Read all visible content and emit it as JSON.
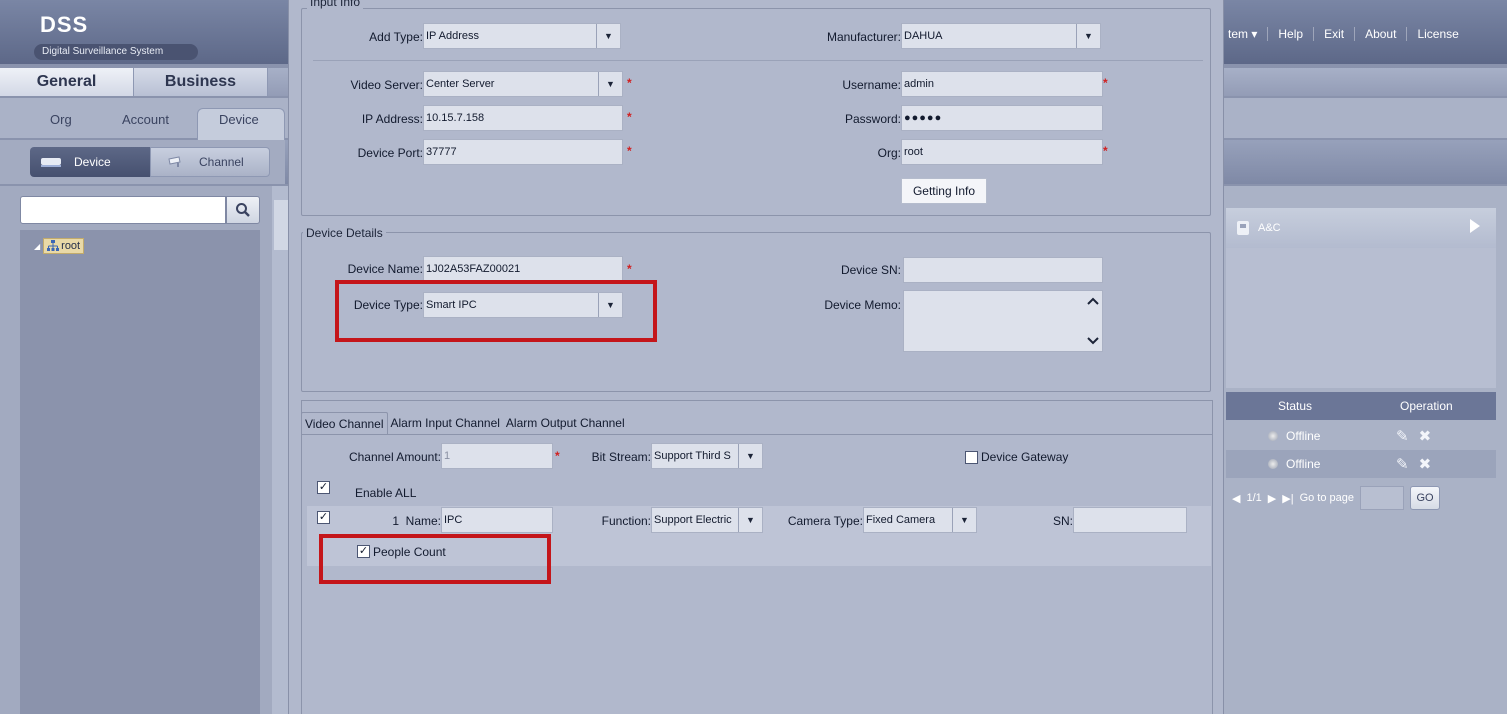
{
  "app": {
    "title": "DSS",
    "subtitle": "Digital Surveillance System",
    "menu": [
      "tem ▾",
      "Help",
      "Exit",
      "About",
      "License"
    ]
  },
  "nav": {
    "main_tabs": [
      "General",
      "Business"
    ],
    "sub_tabs": [
      "Org",
      "Account",
      "Device"
    ],
    "toggle": {
      "device": "Device",
      "channel": "Channel"
    },
    "search_placeholder": "",
    "tree_root": "root"
  },
  "right_panel": {
    "bar_label": "A&C",
    "columns": {
      "status": "Status",
      "operation": "Operation"
    },
    "rows": [
      {
        "status": "Offline"
      },
      {
        "status": "Offline"
      }
    ],
    "pager": {
      "page_text": "1/1",
      "go_to_label": "Go to page",
      "go_button": "GO"
    }
  },
  "dialog": {
    "input_info": {
      "legend": "Input Info",
      "add_type_label": "Add Type:",
      "add_type_value": "IP Address",
      "manufacturer_label": "Manufacturer:",
      "manufacturer_value": "DAHUA",
      "video_server_label": "Video Server:",
      "video_server_value": "Center Server",
      "username_label": "Username:",
      "username_value": "admin",
      "ip_label": "IP Address:",
      "ip_value": "10.15.7.158",
      "password_label": "Password:",
      "password_value": "●●●●●",
      "port_label": "Device Port:",
      "port_value": "37777",
      "org_label": "Org:",
      "org_value": "root",
      "getting_info_button": "Getting Info",
      "required_mark": "*"
    },
    "device_details": {
      "legend": "Device Details",
      "name_label": "Device Name:",
      "name_value": "1J02A53FAZ00021",
      "sn_label": "Device SN:",
      "sn_value": "",
      "type_label": "Device Type:",
      "type_value": "Smart IPC",
      "memo_label": "Device Memo:",
      "memo_value": ""
    },
    "channel_tabs": [
      "Video Channel",
      "Alarm Input Channel",
      "Alarm Output Channel"
    ],
    "video_channel": {
      "amount_label": "Channel Amount:",
      "amount_value": "1",
      "bitstream_label": "Bit Stream:",
      "bitstream_value": "Support Third S",
      "gateway_label": "Device Gateway",
      "enable_all_label": "Enable ALL",
      "row": {
        "index": "1",
        "name_label": "Name:",
        "name_value": "IPC",
        "function_label": "Function:",
        "function_value": "Support Electric",
        "camera_type_label": "Camera Type:",
        "camera_type_value": "Fixed Camera",
        "sn_label": "SN:",
        "sn_value": "",
        "people_count_label": "People Count"
      }
    }
  },
  "colors": {
    "highlight": "#c4151a",
    "required": "#d12020"
  }
}
